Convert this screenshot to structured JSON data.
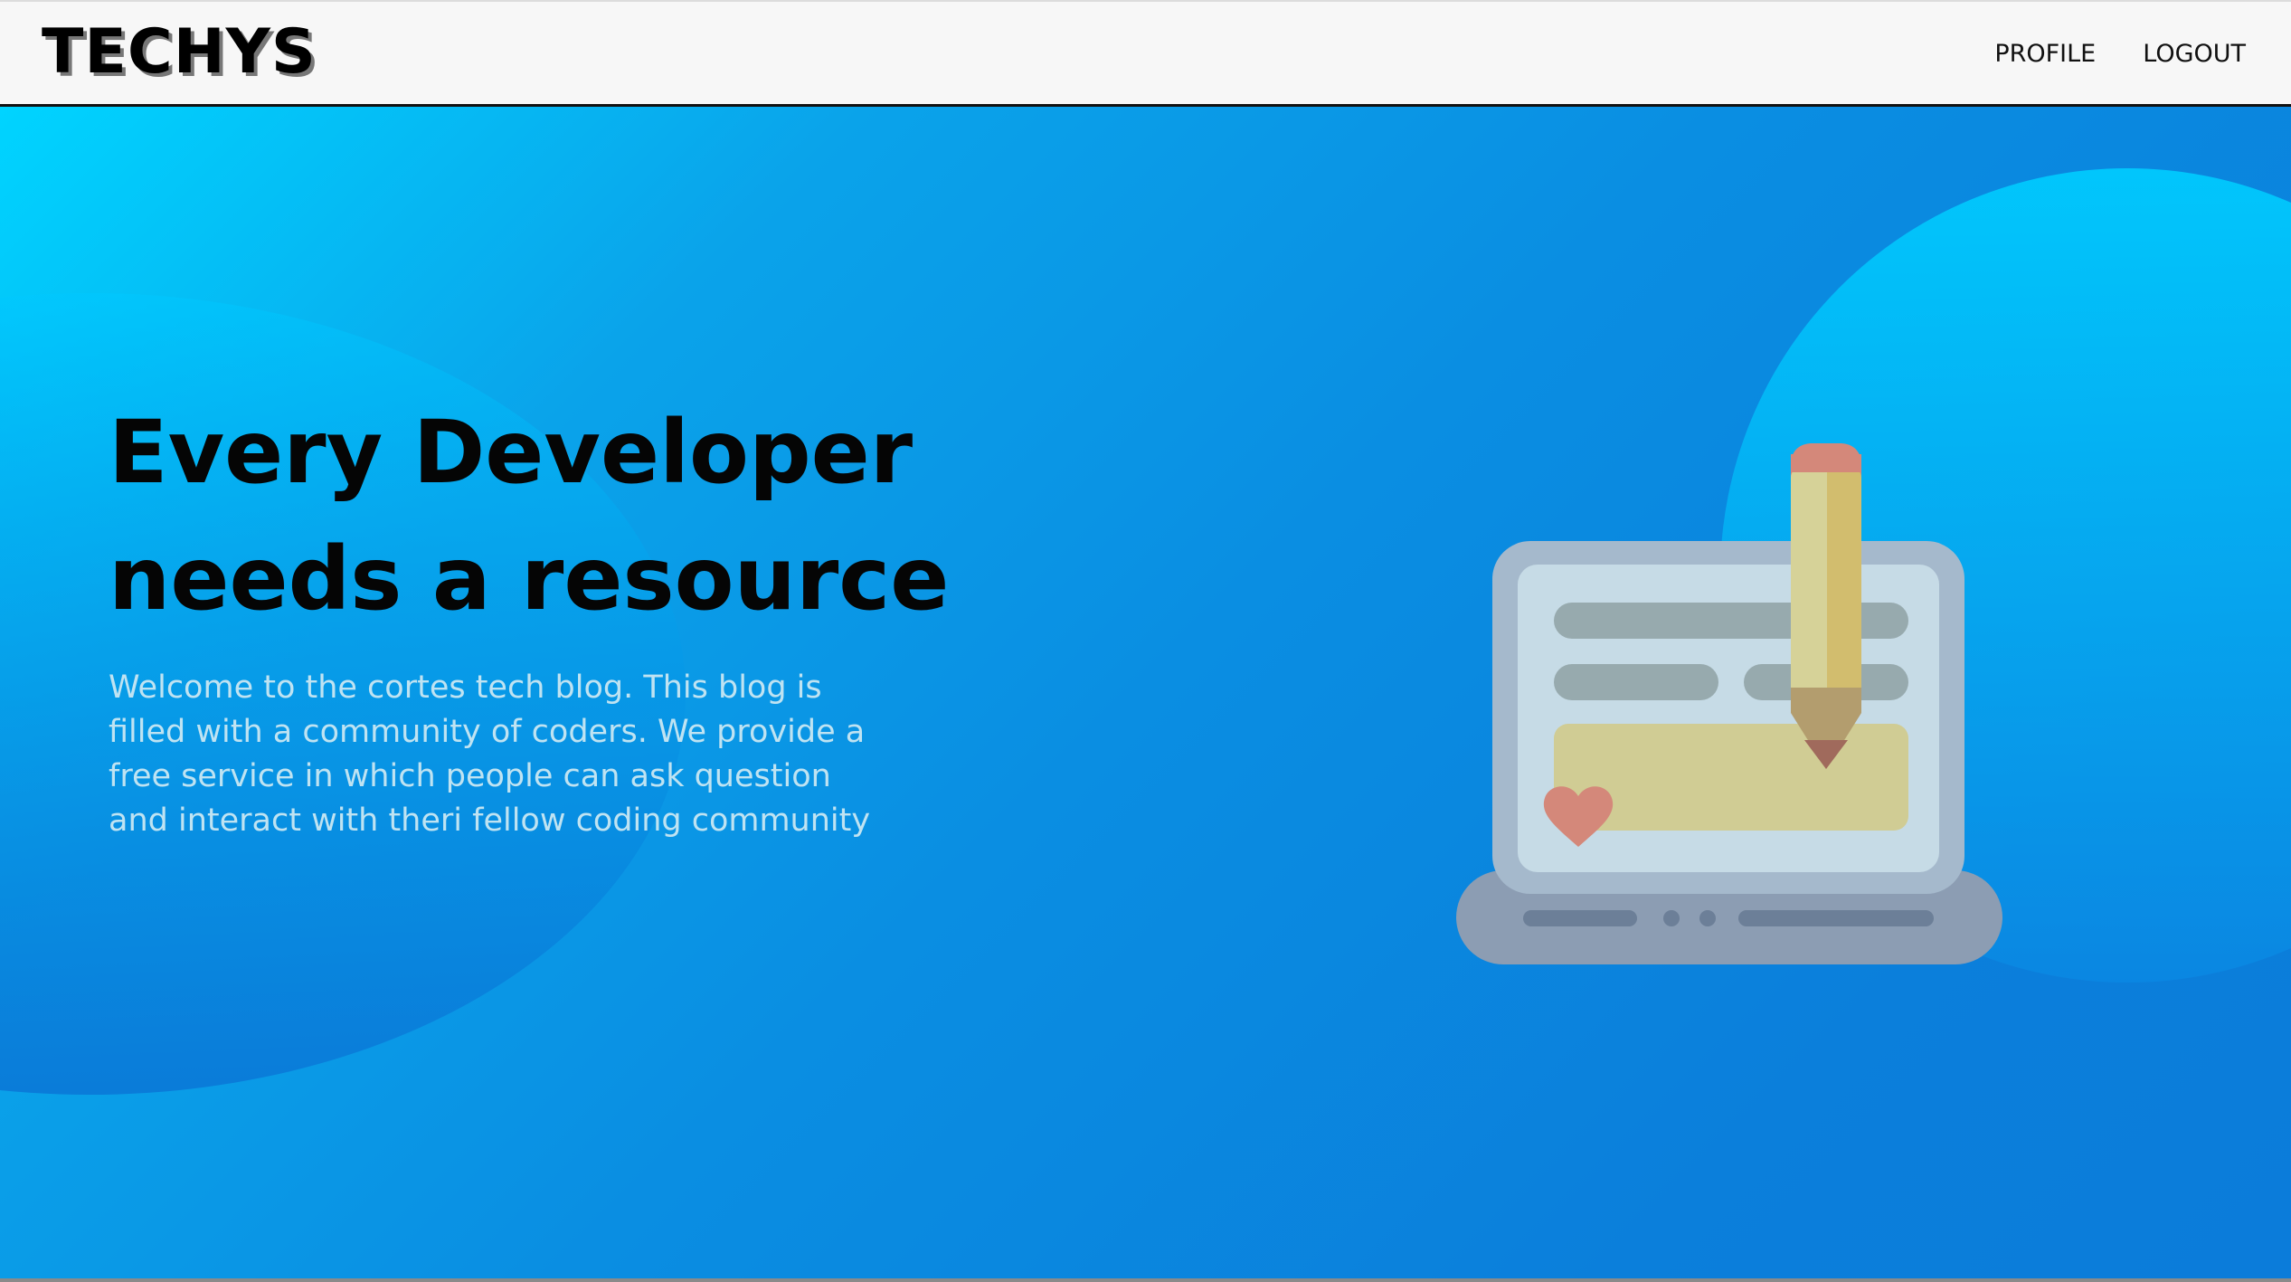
{
  "navbar": {
    "logo": "TECHYS",
    "links": [
      "PROFILE",
      "LOGOUT"
    ]
  },
  "hero": {
    "title_line1": "Every Developer",
    "title_line2": "needs a resource",
    "description": "Welcome to the cortes tech blog. This blog is filled with a community of coders. We provide a free service in which people can ask question and interact with theri fellow coding community"
  },
  "colors": {
    "navbar_bg": "#f7f7f7",
    "hero_gradient_start": "#00d4ff",
    "hero_gradient_end": "#0b7cda",
    "title_color": "#050505",
    "description_color": "#bfe3f2"
  },
  "icons": {
    "illustration": "laptop-with-pencil-and-heart-illustration"
  }
}
